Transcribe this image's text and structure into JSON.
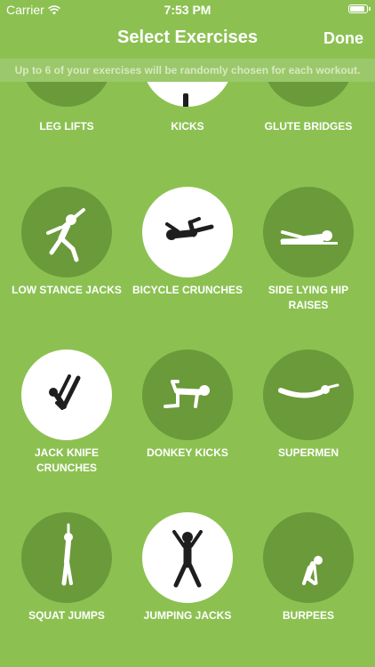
{
  "status_bar": {
    "carrier": "Carrier",
    "time": "7:53 PM"
  },
  "nav": {
    "title": "Select Exercises",
    "done_label": "Done"
  },
  "info": {
    "text": "Up to 6 of your exercises will be randomly chosen for each workout."
  },
  "exercises": [
    {
      "label": "LEG LIFTS",
      "selected": false,
      "icon": "leg-lifts-icon"
    },
    {
      "label": "KICKS",
      "selected": true,
      "icon": "kicks-icon"
    },
    {
      "label": "GLUTE BRIDGES",
      "selected": false,
      "icon": "glute-bridges-icon"
    },
    {
      "label": "LOW STANCE JACKS",
      "selected": false,
      "icon": "low-stance-jacks-icon"
    },
    {
      "label": "BICYCLE CRUNCHES",
      "selected": true,
      "icon": "bicycle-crunches-icon"
    },
    {
      "label": "SIDE LYING HIP RAISES",
      "selected": false,
      "icon": "side-lying-hip-raises-icon"
    },
    {
      "label": "JACK KNIFE CRUNCHES",
      "selected": true,
      "icon": "jack-knife-crunches-icon"
    },
    {
      "label": "DONKEY KICKS",
      "selected": false,
      "icon": "donkey-kicks-icon"
    },
    {
      "label": "SUPERMEN",
      "selected": false,
      "icon": "supermen-icon"
    },
    {
      "label": "SQUAT JUMPS",
      "selected": false,
      "icon": "squat-jumps-icon"
    },
    {
      "label": "JUMPING JACKS",
      "selected": true,
      "icon": "jumping-jacks-icon"
    },
    {
      "label": "BURPEES",
      "selected": false,
      "icon": "burpees-icon"
    }
  ],
  "colors": {
    "background": "#8cc152",
    "circle": "#6a9a3a",
    "circle_selected": "#ffffff",
    "figure_on_selected": "#1e1e1e",
    "figure_on_unselected": "#ffffff"
  }
}
